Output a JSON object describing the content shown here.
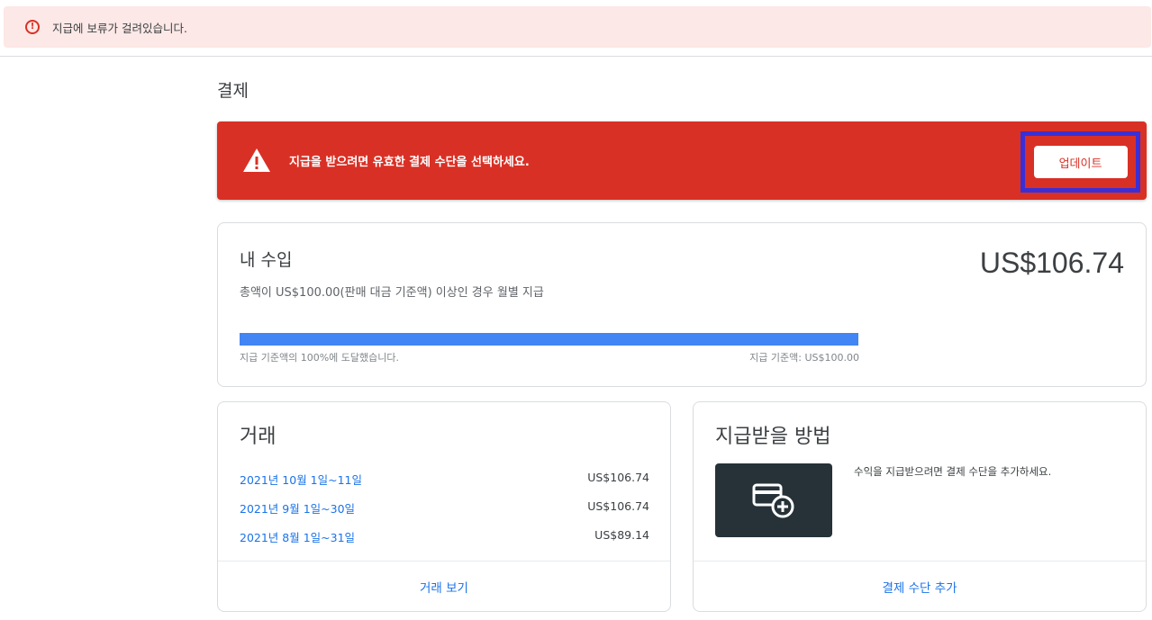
{
  "hold_banner": {
    "icon": "error-outline-icon",
    "text": "지급에 보류가 걸려있습니다."
  },
  "page": {
    "title": "결제"
  },
  "alert": {
    "icon": "warning-triangle-icon",
    "text": "지급을 받으려면 유효한 결제 수단을 선택하세요.",
    "button_label": "업데이트",
    "colors": {
      "background": "#d93025",
      "highlight_border": "#3a2fd6"
    }
  },
  "earnings": {
    "title": "내 수입",
    "amount": "US$106.74",
    "description": "총액이 US$100.00(판매 대금 기준액) 이상인 경우 월별 지급",
    "progress_percent": 100,
    "progress_left_text": "지급 기준액의 100%에 도달했습니다.",
    "progress_right_text": "지급 기준액: US$100.00",
    "progress_color": "#4285f4"
  },
  "transactions": {
    "title": "거래",
    "rows": [
      {
        "period": "2021년 10월 1일~11일",
        "amount": "US$106.74"
      },
      {
        "period": "2021년 9월 1일~30일",
        "amount": "US$106.74"
      },
      {
        "period": "2021년 8월 1일~31일",
        "amount": "US$89.14"
      }
    ],
    "footer_link": "거래 보기"
  },
  "payment_method": {
    "title": "지급받을 방법",
    "thumbnail_icon": "add-card-icon",
    "description": "수익을 지급받으려면 결제 수단을 추가하세요.",
    "footer_link": "결제 수단 추가"
  }
}
